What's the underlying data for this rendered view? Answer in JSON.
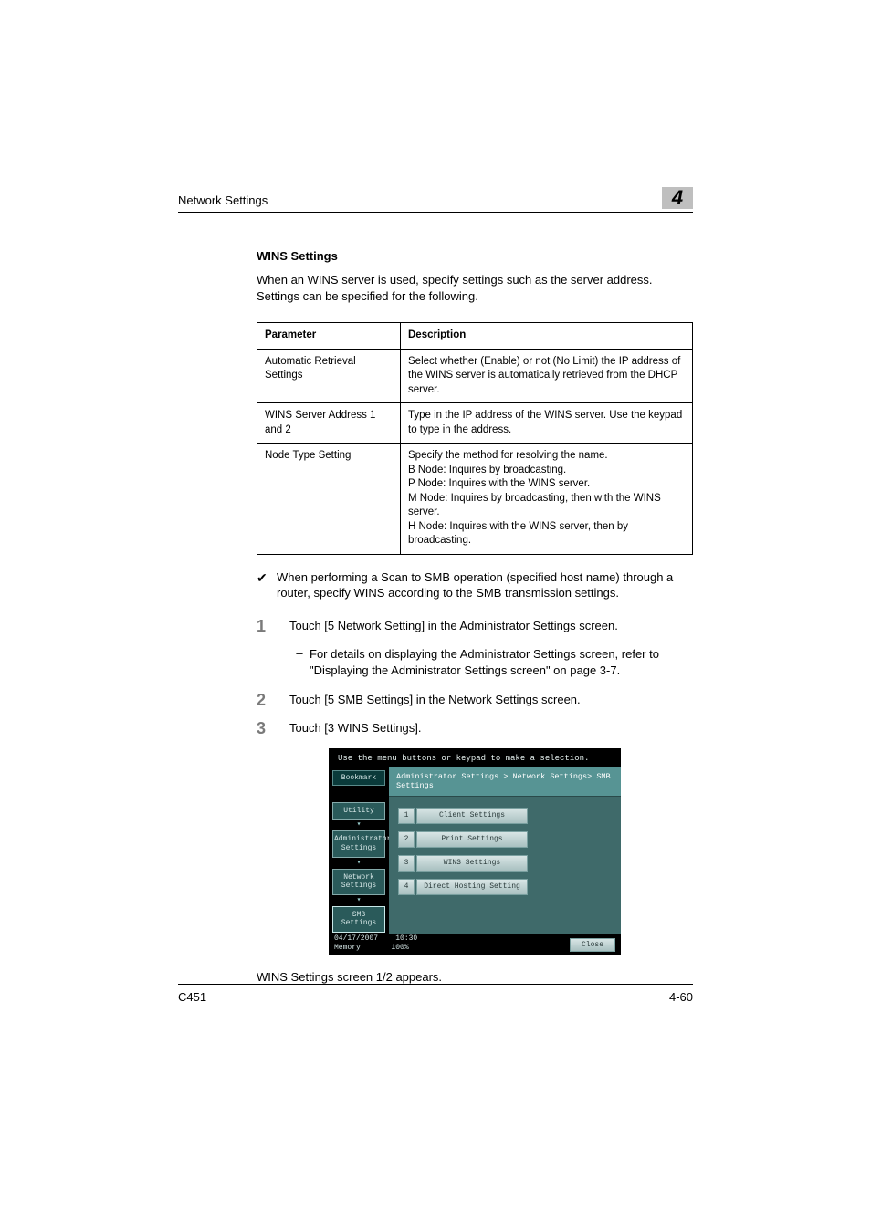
{
  "header": {
    "left": "Network Settings",
    "chapter": "4"
  },
  "section": {
    "heading": "WINS Settings",
    "intro": "When an WINS server is used, specify settings such as the server address. Settings can be specified for the following."
  },
  "table": {
    "head": {
      "param": "Parameter",
      "desc": "Description"
    },
    "rows": [
      {
        "param": "Automatic Retrieval Settings",
        "desc": "Select whether (Enable) or not (No Limit) the IP address of the WINS server is automatically retrieved from the DHCP server."
      },
      {
        "param": "WINS Server Address 1 and 2",
        "desc": "Type in the IP address of the WINS server. Use the keypad to type in the address."
      },
      {
        "param": "Node Type Setting",
        "desc": "Specify the method for resolving the name.\nB Node: Inquires by broadcasting.\nP Node: Inquires with the WINS server.\nM Node: Inquires by broadcasting, then with the WINS server.\nH Node: Inquires with the WINS server, then by broadcasting."
      }
    ]
  },
  "note": "When performing a Scan to SMB operation (specified host name) through a router, specify WINS according to the SMB transmission settings.",
  "steps": [
    {
      "num": "1",
      "text": "Touch [5 Network Setting] in the Administrator Settings screen.",
      "sub": "For details on displaying the Administrator Settings screen, refer to \"Displaying the Administrator Settings screen\" on page 3-7."
    },
    {
      "num": "2",
      "text": "Touch [5 SMB Settings] in the Network Settings screen."
    },
    {
      "num": "3",
      "text": "Touch [3 WINS Settings]."
    }
  ],
  "screenshot": {
    "topbar": "Use the menu buttons or keypad to make a selection.",
    "breadcrumb": "Administrator Settings > Network Settings> SMB Settings",
    "side": {
      "bookmark": "Bookmark",
      "items": [
        "Utility",
        "Administrator Settings",
        "Network Settings",
        "SMB Settings"
      ]
    },
    "menu": [
      {
        "n": "1",
        "label": "Client Settings"
      },
      {
        "n": "2",
        "label": "Print Settings"
      },
      {
        "n": "3",
        "label": "WINS Settings"
      },
      {
        "n": "4",
        "label": "Direct Hosting Setting"
      }
    ],
    "footer": {
      "date": "04/17/2007",
      "time": "10:30",
      "mem_label": "Memory",
      "mem_val": "100%",
      "close": "Close"
    }
  },
  "after_ss": "WINS Settings screen 1/2 appears.",
  "page_footer": {
    "left": "C451",
    "right": "4-60"
  }
}
